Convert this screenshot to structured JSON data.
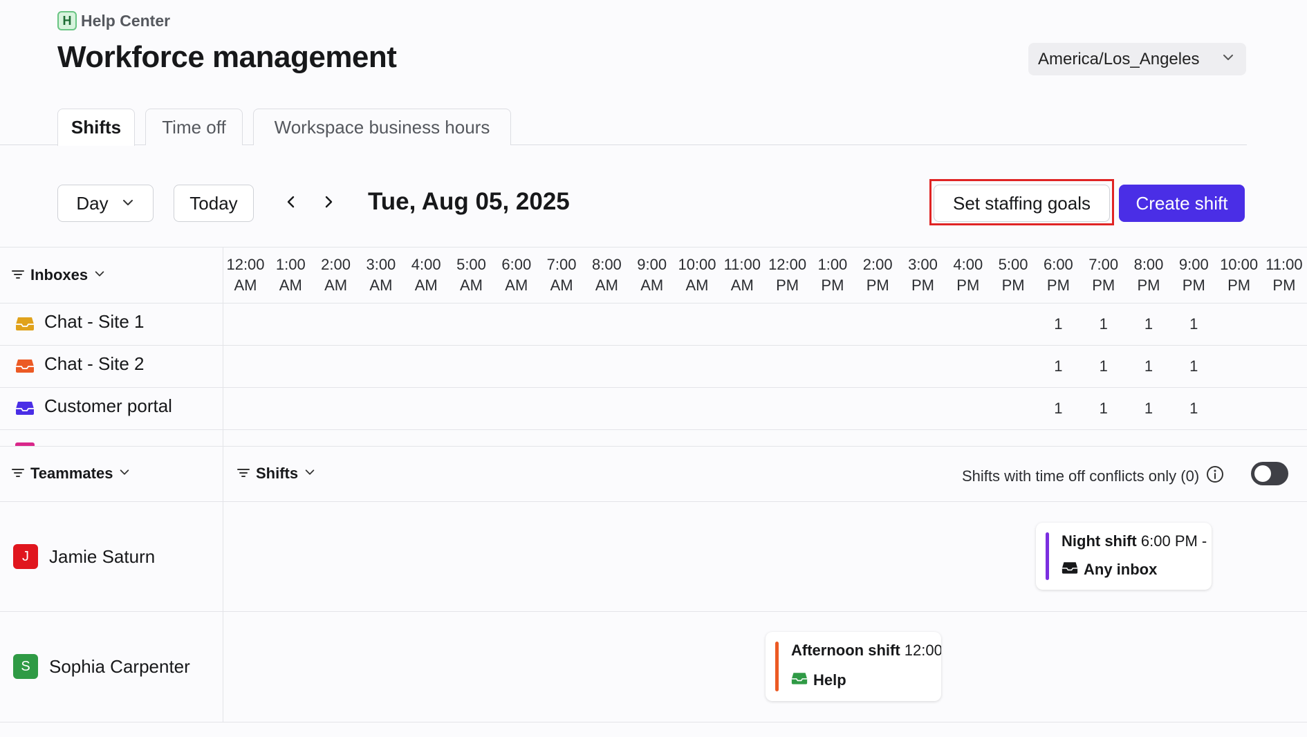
{
  "header": {
    "breadcrumb_badge": "H",
    "breadcrumb_label": "Help Center",
    "title": "Workforce management",
    "timezone": "America/Los_Angeles"
  },
  "tabs": [
    {
      "label": "Shifts",
      "active": true
    },
    {
      "label": "Time off",
      "active": false
    },
    {
      "label": "Workspace business hours",
      "active": false
    }
  ],
  "toolbar": {
    "view_select": "Day",
    "today_label": "Today",
    "date": "Tue, Aug 05, 2025",
    "staffing_goals_label": "Set staffing goals",
    "create_shift_label": "Create shift"
  },
  "inboxes": {
    "filter_label": "Inboxes",
    "hours": [
      [
        "12:00",
        "AM"
      ],
      [
        "1:00",
        "AM"
      ],
      [
        "2:00",
        "AM"
      ],
      [
        "3:00",
        "AM"
      ],
      [
        "4:00",
        "AM"
      ],
      [
        "5:00",
        "AM"
      ],
      [
        "6:00",
        "AM"
      ],
      [
        "7:00",
        "AM"
      ],
      [
        "8:00",
        "AM"
      ],
      [
        "9:00",
        "AM"
      ],
      [
        "10:00",
        "AM"
      ],
      [
        "11:00",
        "AM"
      ],
      [
        "12:00",
        "PM"
      ],
      [
        "1:00",
        "PM"
      ],
      [
        "2:00",
        "PM"
      ],
      [
        "3:00",
        "PM"
      ],
      [
        "4:00",
        "PM"
      ],
      [
        "5:00",
        "PM"
      ],
      [
        "6:00",
        "PM"
      ],
      [
        "7:00",
        "PM"
      ],
      [
        "8:00",
        "PM"
      ],
      [
        "9:00",
        "PM"
      ],
      [
        "10:00",
        "PM"
      ],
      [
        "11:00",
        "PM"
      ]
    ],
    "rows": [
      {
        "name": "Chat - Site 1",
        "color": "#e0a21c",
        "counts": [
          "1",
          "1",
          "1",
          "1"
        ]
      },
      {
        "name": "Chat - Site 2",
        "color": "#ec5a24",
        "counts": [
          "1",
          "1",
          "1",
          "1"
        ]
      },
      {
        "name": "Customer portal",
        "color": "#4a2ee6",
        "counts": [
          "1",
          "1",
          "1",
          "1"
        ]
      }
    ]
  },
  "teammates": {
    "filter_label": "Teammates",
    "shifts_filter_label": "Shifts",
    "conflicts_label": "Shifts with time off conflicts only (0)",
    "people": [
      {
        "initial": "J",
        "name": "Jamie Saturn",
        "color": "#e0161e"
      },
      {
        "initial": "S",
        "name": "Sophia Carpenter",
        "color": "#2f9a45"
      }
    ]
  },
  "shifts": [
    {
      "name": "Night shift",
      "time": "6:00 PM -",
      "inbox": "Any inbox",
      "bar_color": "#7b2fe0",
      "icon_color": "#17181a"
    },
    {
      "name": "Afternoon shift",
      "time": "12:00",
      "inbox": "Help",
      "bar_color": "#ec5a24",
      "icon_color": "#2f9a45"
    }
  ]
}
